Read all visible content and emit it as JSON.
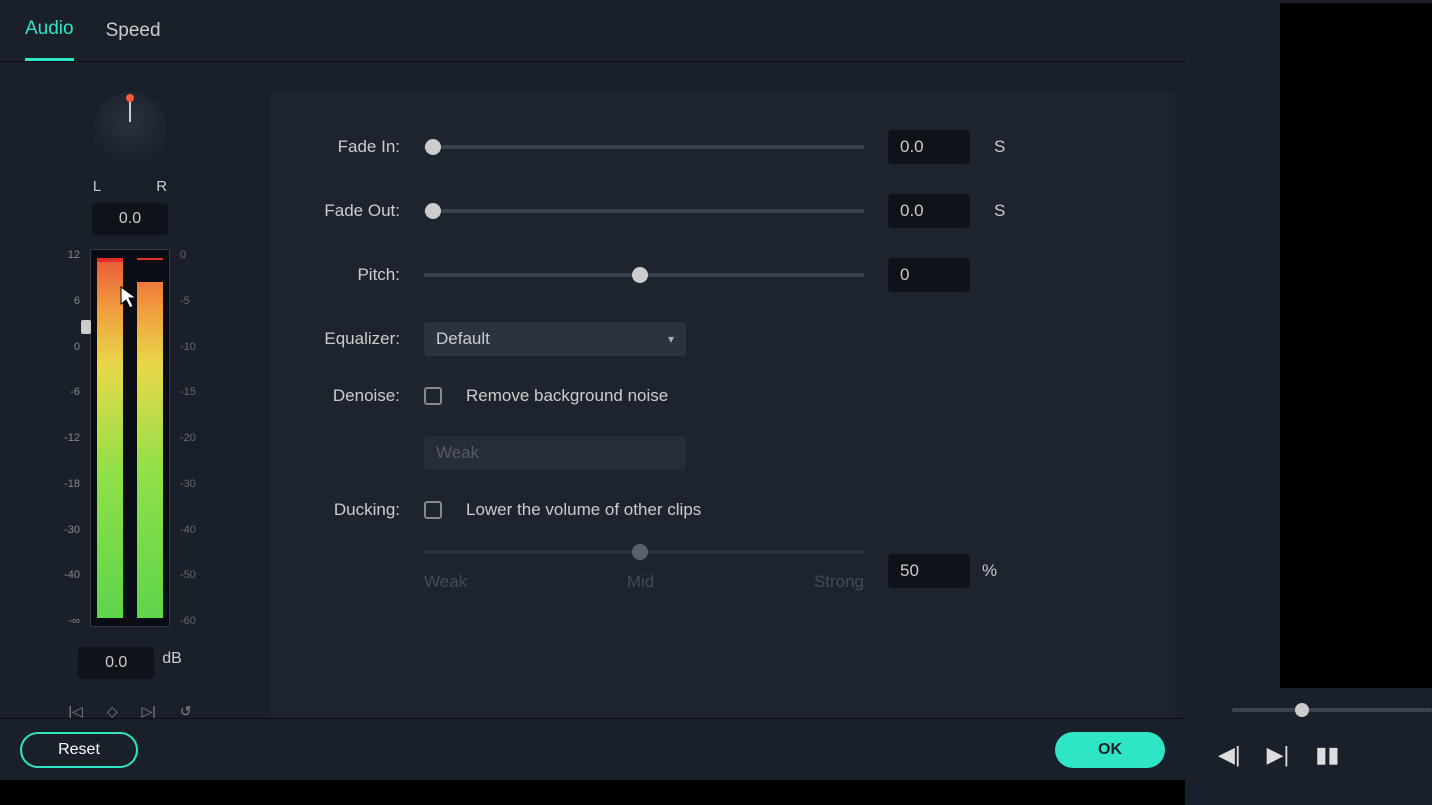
{
  "tabs": {
    "audio": "Audio",
    "speed": "Speed"
  },
  "balance": {
    "l": "L",
    "r": "R",
    "value": "0.0",
    "scale_left": [
      "12",
      "6",
      "0",
      "-6",
      "-12",
      "-18",
      "-30",
      "-40",
      "-∞"
    ],
    "scale_right": [
      "0",
      "-5",
      "-10",
      "-15",
      "-20",
      "-30",
      "-40",
      "-50",
      "-60"
    ],
    "db_value": "0.0",
    "db_unit": "dB",
    "kf": {
      "prev": "K",
      "add": "◇",
      "next": "⤒",
      "reset": "↺"
    }
  },
  "settings": {
    "fadein": {
      "label": "Fade In:",
      "value": "0.0",
      "unit": "S"
    },
    "fadeout": {
      "label": "Fade Out:",
      "value": "0.0",
      "unit": "S"
    },
    "pitch": {
      "label": "Pitch:",
      "value": "0"
    },
    "equalizer": {
      "label": "Equalizer:",
      "value": "Default"
    },
    "denoise": {
      "label": "Denoise:",
      "option": "Remove background noise",
      "strength": "Weak"
    },
    "ducking": {
      "label": "Ducking:",
      "option": "Lower the volume of other clips",
      "value": "50",
      "unit": "%",
      "weak": "Weak",
      "mid": "Mid",
      "strong": "Strong"
    }
  },
  "buttons": {
    "reset": "Reset",
    "ok": "OK"
  }
}
